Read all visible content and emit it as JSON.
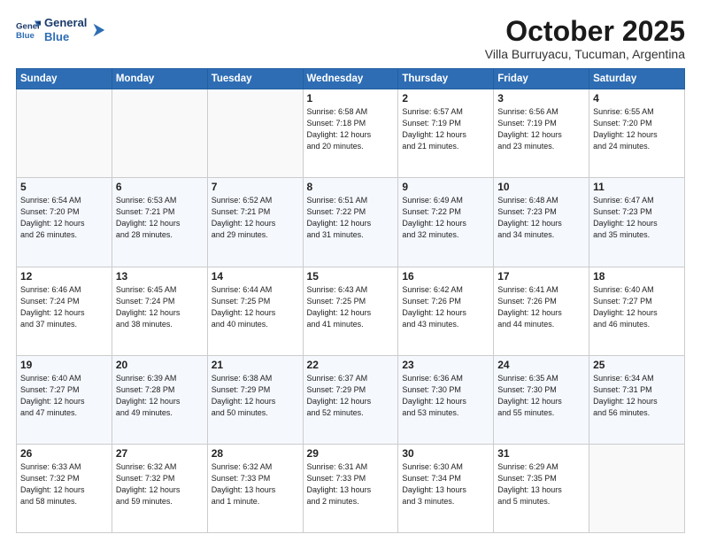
{
  "header": {
    "logo_line1": "General",
    "logo_line2": "Blue",
    "month": "October 2025",
    "location": "Villa Burruyacu, Tucuman, Argentina"
  },
  "weekdays": [
    "Sunday",
    "Monday",
    "Tuesday",
    "Wednesday",
    "Thursday",
    "Friday",
    "Saturday"
  ],
  "weeks": [
    [
      {
        "day": "",
        "info": ""
      },
      {
        "day": "",
        "info": ""
      },
      {
        "day": "",
        "info": ""
      },
      {
        "day": "1",
        "info": "Sunrise: 6:58 AM\nSunset: 7:18 PM\nDaylight: 12 hours\nand 20 minutes."
      },
      {
        "day": "2",
        "info": "Sunrise: 6:57 AM\nSunset: 7:19 PM\nDaylight: 12 hours\nand 21 minutes."
      },
      {
        "day": "3",
        "info": "Sunrise: 6:56 AM\nSunset: 7:19 PM\nDaylight: 12 hours\nand 23 minutes."
      },
      {
        "day": "4",
        "info": "Sunrise: 6:55 AM\nSunset: 7:20 PM\nDaylight: 12 hours\nand 24 minutes."
      }
    ],
    [
      {
        "day": "5",
        "info": "Sunrise: 6:54 AM\nSunset: 7:20 PM\nDaylight: 12 hours\nand 26 minutes."
      },
      {
        "day": "6",
        "info": "Sunrise: 6:53 AM\nSunset: 7:21 PM\nDaylight: 12 hours\nand 28 minutes."
      },
      {
        "day": "7",
        "info": "Sunrise: 6:52 AM\nSunset: 7:21 PM\nDaylight: 12 hours\nand 29 minutes."
      },
      {
        "day": "8",
        "info": "Sunrise: 6:51 AM\nSunset: 7:22 PM\nDaylight: 12 hours\nand 31 minutes."
      },
      {
        "day": "9",
        "info": "Sunrise: 6:49 AM\nSunset: 7:22 PM\nDaylight: 12 hours\nand 32 minutes."
      },
      {
        "day": "10",
        "info": "Sunrise: 6:48 AM\nSunset: 7:23 PM\nDaylight: 12 hours\nand 34 minutes."
      },
      {
        "day": "11",
        "info": "Sunrise: 6:47 AM\nSunset: 7:23 PM\nDaylight: 12 hours\nand 35 minutes."
      }
    ],
    [
      {
        "day": "12",
        "info": "Sunrise: 6:46 AM\nSunset: 7:24 PM\nDaylight: 12 hours\nand 37 minutes."
      },
      {
        "day": "13",
        "info": "Sunrise: 6:45 AM\nSunset: 7:24 PM\nDaylight: 12 hours\nand 38 minutes."
      },
      {
        "day": "14",
        "info": "Sunrise: 6:44 AM\nSunset: 7:25 PM\nDaylight: 12 hours\nand 40 minutes."
      },
      {
        "day": "15",
        "info": "Sunrise: 6:43 AM\nSunset: 7:25 PM\nDaylight: 12 hours\nand 41 minutes."
      },
      {
        "day": "16",
        "info": "Sunrise: 6:42 AM\nSunset: 7:26 PM\nDaylight: 12 hours\nand 43 minutes."
      },
      {
        "day": "17",
        "info": "Sunrise: 6:41 AM\nSunset: 7:26 PM\nDaylight: 12 hours\nand 44 minutes."
      },
      {
        "day": "18",
        "info": "Sunrise: 6:40 AM\nSunset: 7:27 PM\nDaylight: 12 hours\nand 46 minutes."
      }
    ],
    [
      {
        "day": "19",
        "info": "Sunrise: 6:40 AM\nSunset: 7:27 PM\nDaylight: 12 hours\nand 47 minutes."
      },
      {
        "day": "20",
        "info": "Sunrise: 6:39 AM\nSunset: 7:28 PM\nDaylight: 12 hours\nand 49 minutes."
      },
      {
        "day": "21",
        "info": "Sunrise: 6:38 AM\nSunset: 7:29 PM\nDaylight: 12 hours\nand 50 minutes."
      },
      {
        "day": "22",
        "info": "Sunrise: 6:37 AM\nSunset: 7:29 PM\nDaylight: 12 hours\nand 52 minutes."
      },
      {
        "day": "23",
        "info": "Sunrise: 6:36 AM\nSunset: 7:30 PM\nDaylight: 12 hours\nand 53 minutes."
      },
      {
        "day": "24",
        "info": "Sunrise: 6:35 AM\nSunset: 7:30 PM\nDaylight: 12 hours\nand 55 minutes."
      },
      {
        "day": "25",
        "info": "Sunrise: 6:34 AM\nSunset: 7:31 PM\nDaylight: 12 hours\nand 56 minutes."
      }
    ],
    [
      {
        "day": "26",
        "info": "Sunrise: 6:33 AM\nSunset: 7:32 PM\nDaylight: 12 hours\nand 58 minutes."
      },
      {
        "day": "27",
        "info": "Sunrise: 6:32 AM\nSunset: 7:32 PM\nDaylight: 12 hours\nand 59 minutes."
      },
      {
        "day": "28",
        "info": "Sunrise: 6:32 AM\nSunset: 7:33 PM\nDaylight: 13 hours\nand 1 minute."
      },
      {
        "day": "29",
        "info": "Sunrise: 6:31 AM\nSunset: 7:33 PM\nDaylight: 13 hours\nand 2 minutes."
      },
      {
        "day": "30",
        "info": "Sunrise: 6:30 AM\nSunset: 7:34 PM\nDaylight: 13 hours\nand 3 minutes."
      },
      {
        "day": "31",
        "info": "Sunrise: 6:29 AM\nSunset: 7:35 PM\nDaylight: 13 hours\nand 5 minutes."
      },
      {
        "day": "",
        "info": ""
      }
    ]
  ]
}
